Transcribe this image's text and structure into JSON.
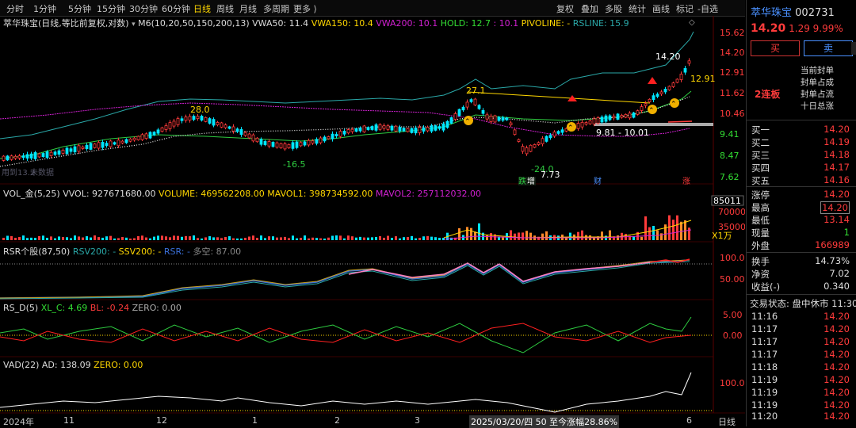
{
  "toolbar": {
    "periods": [
      "分时",
      "1分钟",
      "5分钟",
      "15分钟",
      "30分钟",
      "60分钟",
      "日线",
      "周线",
      "月线",
      "多周期",
      "更多 ⟩"
    ],
    "active_period": "日线",
    "right_buttons": [
      "复权",
      "叠加",
      "多股",
      "统计",
      "画线",
      "标记",
      "-自选"
    ]
  },
  "main_indicator": {
    "title": "萃华珠宝(日线,等比前复权,对数)",
    "ma": "M6(10,20,50,150,200,13)",
    "vwa50": "VWA50: 11.4",
    "vwa150": "VWA150: 10.4",
    "vwa200": "VWA200: 10.1",
    "hold": "HOLD: 12.7",
    "hold2": "10.1",
    "pivoline": "PIVOLINE: -",
    "rsline": "RSLINE: 15.9"
  },
  "main_axis": [
    "15.62",
    "14.20",
    "12.91",
    "11.62",
    "10.46",
    "9.41",
    "8.47",
    "7.62"
  ],
  "main_annotations": {
    "hi28": "28.0",
    "hi27": "27.1",
    "low165": "-16.5",
    "low24": "-24.0",
    "low773": "7.73",
    "range": "9.81 - 10.01",
    "price1420": "14.20",
    "price1291": "12.91",
    "wm": "用到13.2",
    "wm2": "未数据",
    "tag_die": "跌",
    "tag_zeng": "增",
    "tag_cai": "财",
    "tag_zhang": "涨"
  },
  "vol_indicator": {
    "title": "VOL_金(5,25)",
    "vvol": "VVOL: 927671680.00",
    "volume": "VOLUME: 469562208.00",
    "mavol1": "MAVOL1: 398734592.00",
    "mavol2": "MAVOL2: 257112032.00",
    "axis": [
      "85011",
      "70000",
      "35000",
      "X1万"
    ]
  },
  "rsr_indicator": {
    "title": "RSR个股(87,50)",
    "rsv200": "RSV200: -",
    "ssv200": "SSV200: -",
    "rsr": "RSR: -",
    "duokong": "多空: 87.00",
    "axis": [
      "100.0",
      "50.00"
    ]
  },
  "rsd_indicator": {
    "title": "RS_D(5)",
    "xlc": "XL_C: 4.69",
    "bl": "BL: -0.24",
    "zero": "ZERO: 0.00",
    "axis": [
      "5.00",
      "0.00"
    ]
  },
  "vad_indicator": {
    "title": "VAD(22)",
    "ad": "AD: 138.09",
    "zero": "ZERO: 0.00",
    "axis": [
      "100.0"
    ]
  },
  "xaxis": {
    "labels": [
      "2024年",
      "11",
      "12",
      "1",
      "2",
      "3",
      "4",
      "5",
      "6"
    ],
    "cursor": "2025/03/20/四 50 至今涨幅28.86%",
    "period": "日线"
  },
  "stock": {
    "name": "萃华珠宝",
    "code": "002731",
    "price": "14.20",
    "change": "1.29",
    "pct": "9.99%",
    "buy": "买",
    "sell": "卖",
    "board": "2连板",
    "seal_lines": [
      "当前封单",
      "封单占成",
      "封单占流",
      "十日总涨"
    ]
  },
  "order_book": [
    {
      "label": "买一",
      "value": "14.20"
    },
    {
      "label": "买二",
      "value": "14.19"
    },
    {
      "label": "买三",
      "value": "14.18"
    },
    {
      "label": "买四",
      "value": "14.17"
    },
    {
      "label": "买五",
      "value": "14.16"
    }
  ],
  "stats": [
    {
      "label": "涨停",
      "value": "14.20",
      "color": "red"
    },
    {
      "label": "最高",
      "value": "14.20",
      "color": "red"
    },
    {
      "label": "最低",
      "value": "13.14",
      "color": "red"
    },
    {
      "label": "现量",
      "value": "1",
      "color": "grn"
    },
    {
      "label": "外盘",
      "value": "166989",
      "color": "red"
    }
  ],
  "fundamentals": [
    {
      "label": "换手",
      "value": "14.73%"
    },
    {
      "label": "净资",
      "value": "7.02"
    },
    {
      "label": "收益(-)",
      "value": "0.340"
    }
  ],
  "trade_status": "交易状态: 盘中休市 11:30",
  "ticks": [
    {
      "time": "11:16",
      "price": "14.20"
    },
    {
      "time": "11:17",
      "price": "14.20"
    },
    {
      "time": "11:17",
      "price": "14.20"
    },
    {
      "time": "11:17",
      "price": "14.20"
    },
    {
      "time": "11:18",
      "price": "14.20"
    },
    {
      "time": "11:19",
      "price": "14.20"
    },
    {
      "time": "11:19",
      "price": "14.20"
    },
    {
      "time": "11:19",
      "price": "14.20"
    },
    {
      "time": "11:20",
      "price": "14.20"
    },
    {
      "time": "11:21",
      "price": "14.20"
    }
  ],
  "colors": {
    "up": "#ff3b3b",
    "down": "#00e5ff",
    "ma_yellow": "#ffd700",
    "ma_magenta": "#d020d0",
    "ma_green": "#2ecc40",
    "ma_cyan": "#2aa8a8"
  }
}
